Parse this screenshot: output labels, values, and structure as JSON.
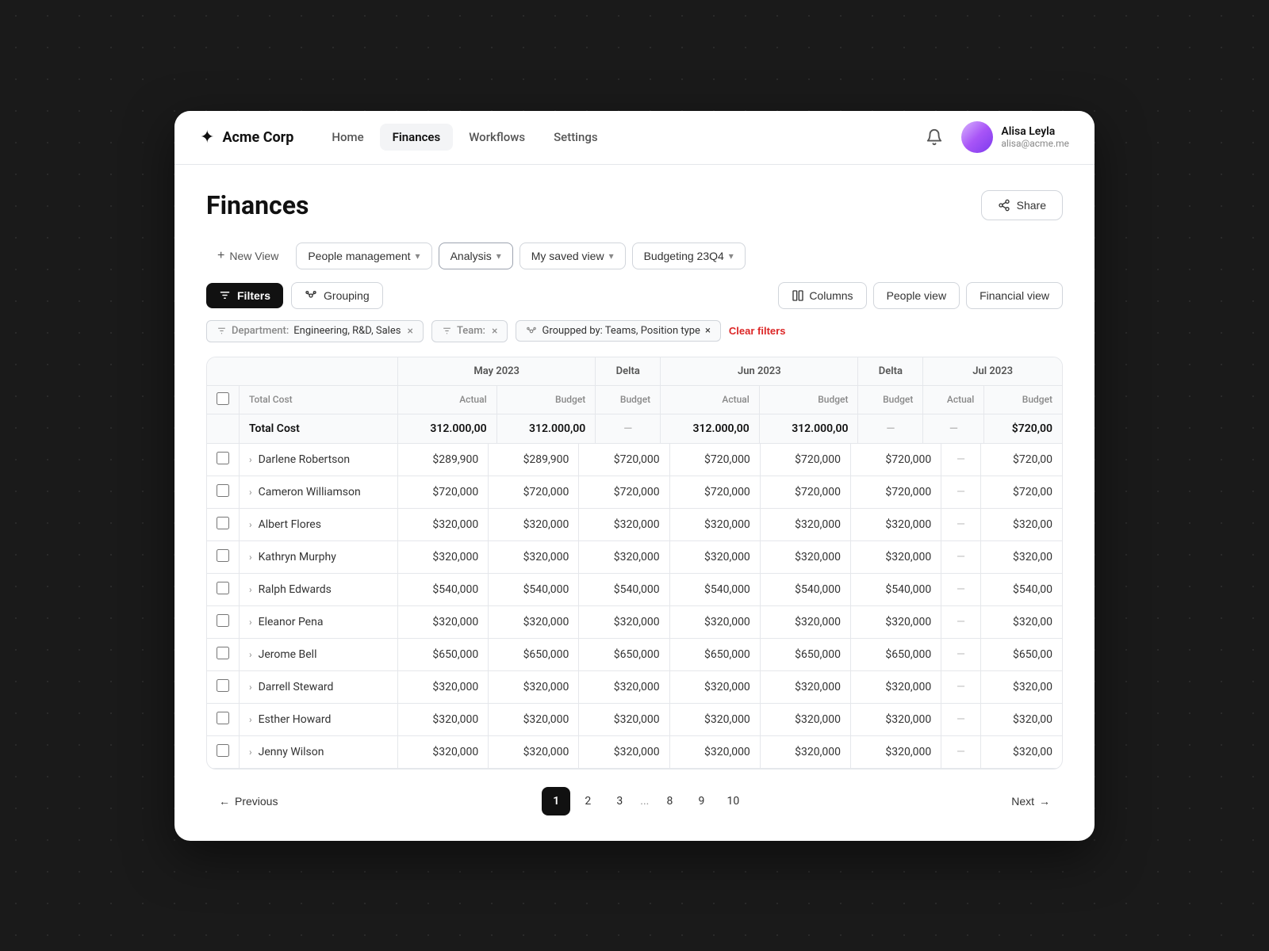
{
  "background": {
    "dot_color": "#444"
  },
  "navbar": {
    "logo_text": "Acme Corp",
    "nav_items": [
      {
        "label": "Home",
        "active": false
      },
      {
        "label": "Finances",
        "active": true
      },
      {
        "label": "Workflows",
        "active": false
      },
      {
        "label": "Settings",
        "active": false
      }
    ],
    "user": {
      "name": "Alisa Leyla",
      "email": "alisa@acme.me"
    },
    "bell_icon": "🔔"
  },
  "page": {
    "title": "Finances",
    "share_label": "Share"
  },
  "view_tabs": [
    {
      "label": "New View",
      "type": "new"
    },
    {
      "label": "People management",
      "type": "tab",
      "has_chevron": true
    },
    {
      "label": "Analysis",
      "type": "tab",
      "active": true,
      "has_chevron": true
    },
    {
      "label": "My saved view",
      "type": "tab",
      "has_chevron": true
    },
    {
      "label": "Budgeting 23Q4",
      "type": "tab",
      "has_chevron": true
    }
  ],
  "toolbar": {
    "filter_label": "Filters",
    "grouping_label": "Grouping",
    "columns_label": "Columns",
    "people_view_label": "People view",
    "financial_view_label": "Financial view"
  },
  "active_filters": [
    {
      "prefix": "Department:",
      "value": "Engineering, R&D, Sales",
      "removable": true
    },
    {
      "prefix": "Team:",
      "value": "",
      "removable": true
    },
    {
      "prefix": "Grouped by:",
      "value": "Teams, Position type",
      "removable": true,
      "icon": "group"
    }
  ],
  "clear_filters_label": "Clear filters",
  "table": {
    "month_groups": [
      {
        "label": "May 2023",
        "span": 2
      },
      {
        "label": "Delta",
        "span": 1
      },
      {
        "label": "Jun 2023",
        "span": 2
      },
      {
        "label": "Delta",
        "span": 1
      },
      {
        "label": "Jul 2023",
        "span": 2
      }
    ],
    "sub_headers": [
      "Total Cost",
      "Actual",
      "Budget",
      "Budget",
      "Actual",
      "Budget",
      "Budget",
      "Actual",
      "Budget"
    ],
    "total_row": {
      "label": "Total Cost",
      "values": [
        "312.000,00",
        "312.000,00",
        "—",
        "312.000,00",
        "312.000,00",
        "—",
        "—",
        "$720,00"
      ]
    },
    "rows": [
      {
        "name": "Darlene Robertson",
        "values": [
          "$289,900",
          "$289,900",
          "$720,000",
          "$720,000",
          "$720,000",
          "$720,000",
          "—",
          "$720,00"
        ]
      },
      {
        "name": "Cameron Williamson",
        "values": [
          "$720,000",
          "$720,000",
          "$720,000",
          "$720,000",
          "$720,000",
          "$720,000",
          "—",
          "$720,00"
        ]
      },
      {
        "name": "Albert Flores",
        "values": [
          "$320,000",
          "$320,000",
          "$320,000",
          "$320,000",
          "$320,000",
          "$320,000",
          "—",
          "$320,00"
        ]
      },
      {
        "name": "Kathryn Murphy",
        "values": [
          "$320,000",
          "$320,000",
          "$320,000",
          "$320,000",
          "$320,000",
          "$320,000",
          "—",
          "$320,00"
        ]
      },
      {
        "name": "Ralph Edwards",
        "values": [
          "$540,000",
          "$540,000",
          "$540,000",
          "$540,000",
          "$540,000",
          "$540,000",
          "—",
          "$540,00"
        ]
      },
      {
        "name": "Eleanor Pena",
        "values": [
          "$320,000",
          "$320,000",
          "$320,000",
          "$320,000",
          "$320,000",
          "$320,000",
          "—",
          "$320,00"
        ]
      },
      {
        "name": "Jerome Bell",
        "values": [
          "$650,000",
          "$650,000",
          "$650,000",
          "$650,000",
          "$650,000",
          "$650,000",
          "—",
          "$650,00"
        ]
      },
      {
        "name": "Darrell Steward",
        "values": [
          "$320,000",
          "$320,000",
          "$320,000",
          "$320,000",
          "$320,000",
          "$320,000",
          "—",
          "$320,00"
        ]
      },
      {
        "name": "Esther Howard",
        "values": [
          "$320,000",
          "$320,000",
          "$320,000",
          "$320,000",
          "$320,000",
          "$320,000",
          "—",
          "$320,00"
        ]
      },
      {
        "name": "Jenny Wilson",
        "values": [
          "$320,000",
          "$320,000",
          "$320,000",
          "$320,000",
          "$320,000",
          "$320,000",
          "—",
          "$320,00"
        ]
      }
    ]
  },
  "pagination": {
    "prev_label": "Previous",
    "next_label": "Next",
    "pages": [
      "1",
      "2",
      "3",
      "...",
      "8",
      "9",
      "10"
    ],
    "active_page": "1"
  }
}
